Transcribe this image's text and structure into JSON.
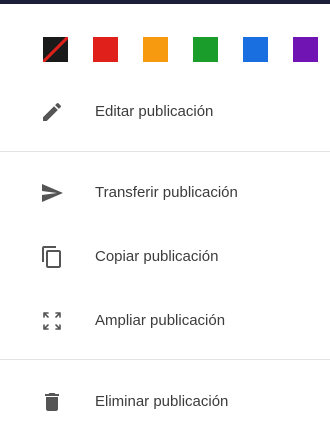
{
  "colors": {
    "swatches": [
      {
        "name": "none",
        "hex": "#1a1a1a",
        "slash": "#e0201b"
      },
      {
        "name": "red",
        "hex": "#e0201b"
      },
      {
        "name": "orange",
        "hex": "#f79a10"
      },
      {
        "name": "green",
        "hex": "#1a9d2a"
      },
      {
        "name": "blue",
        "hex": "#1a6fe0"
      },
      {
        "name": "purple",
        "hex": "#7014b4"
      }
    ],
    "icon": "#555555",
    "text": "#3c3c3c",
    "divider": "#e3e3e3"
  },
  "menu": {
    "edit": {
      "label": "Editar publicación",
      "icon": "pencil-icon"
    },
    "transfer": {
      "label": "Transferir publicación",
      "icon": "send-icon"
    },
    "copy": {
      "label": "Copiar publicación",
      "icon": "copy-icon"
    },
    "expand": {
      "label": "Ampliar publicación",
      "icon": "expand-icon"
    },
    "delete": {
      "label": "Eliminar publicación",
      "icon": "trash-icon"
    }
  }
}
